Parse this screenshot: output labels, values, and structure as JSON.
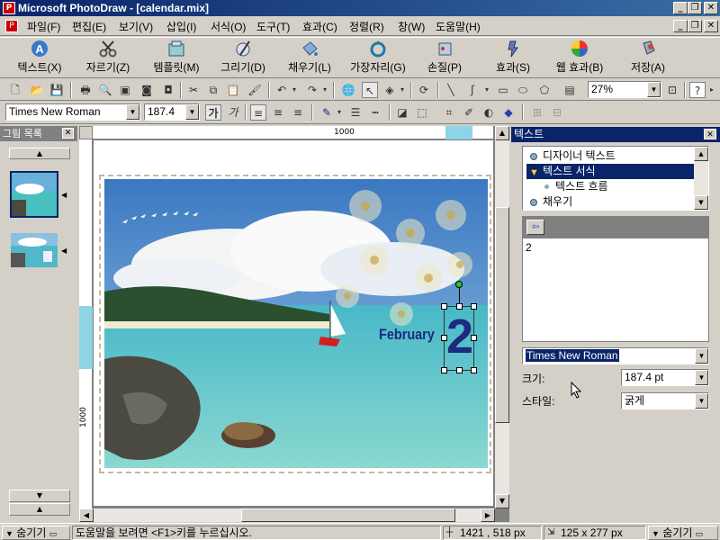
{
  "window": {
    "title": "Microsoft PhotoDraw - [calendar.mix]",
    "min_icon": "_",
    "restore_icon": "❐",
    "close_icon": "✕"
  },
  "menu": [
    "파일(F)",
    "편집(E)",
    "보기(V)",
    "삽입(I)",
    "서식(O)",
    "도구(T)",
    "효과(C)",
    "정렬(R)",
    "창(W)",
    "도움말(H)"
  ],
  "bigtools": [
    {
      "label": "텍스트(X)",
      "icon": "text-icon"
    },
    {
      "label": "자르기(Z)",
      "icon": "scissors-icon"
    },
    {
      "label": "템플릿(M)",
      "icon": "template-icon"
    },
    {
      "label": "그리기(D)",
      "icon": "draw-icon"
    },
    {
      "label": "채우기(L)",
      "icon": "fill-icon"
    },
    {
      "label": "가장자리(G)",
      "icon": "edge-icon"
    },
    {
      "label": "손질(P)",
      "icon": "touchup-icon"
    },
    {
      "label": "효과(S)",
      "icon": "effects-icon"
    },
    {
      "label": "웹 효과(B)",
      "icon": "web-effects-icon"
    },
    {
      "label": "저장(A)",
      "icon": "save-icon"
    }
  ],
  "toolbar": {
    "zoom": "27%"
  },
  "format": {
    "font": "Times New Roman",
    "size": "187.4"
  },
  "leftpanel": {
    "title": "그림 목록",
    "scroll_up": "▲",
    "scroll_down_1": "▼",
    "scroll_down_2": "▲"
  },
  "canvas": {
    "ruler_top": "1000",
    "ruler_left": "1000",
    "text_month": "February",
    "text_day": "2"
  },
  "rightpanel": {
    "title": "텍스트",
    "tree": [
      {
        "label": "디자이너 텍스트",
        "selected": false
      },
      {
        "label": "텍스트 서식",
        "selected": true
      },
      {
        "label": "텍스트 흐름",
        "selected": false
      },
      {
        "label": "채우기",
        "selected": false
      }
    ],
    "text_content": "2",
    "font": "Times New Roman",
    "size_label": "크기:",
    "size_value": "187.4 pt",
    "style_label": "스타일:",
    "style_value": "굵게"
  },
  "status": {
    "hide_left": "숨기기",
    "message": "도움말을 보려면 <F1>키를 누르십시오.",
    "coords": "1421 , 518  px",
    "dims": "125 x 277  px",
    "hide_right": "숨기기"
  },
  "colors": {
    "titlebar": "#0a246a",
    "selection": "#0a246a",
    "text_blue": "#1c2a80"
  }
}
